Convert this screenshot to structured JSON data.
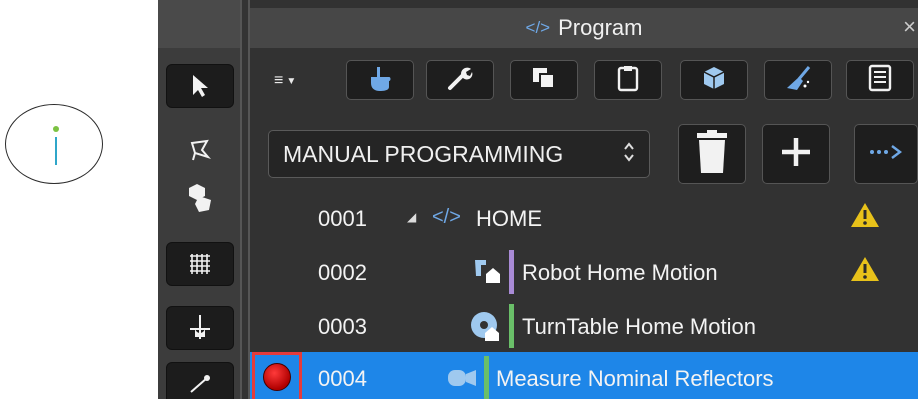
{
  "panel": {
    "title": "Program",
    "close_glyph": "×"
  },
  "left_tools": [
    {
      "name": "select-arrow-icon"
    },
    {
      "name": "lasso-icon"
    },
    {
      "name": "object-select-icon"
    },
    {
      "name": "grid-icon"
    },
    {
      "name": "move-icon"
    },
    {
      "name": "measure-tool-icon"
    }
  ],
  "toolbar": {
    "menu_glyph": "≡",
    "buttons": [
      {
        "name": "hand-icon"
      },
      {
        "name": "wrench-icon"
      },
      {
        "name": "copy-icon"
      },
      {
        "name": "clipboard-icon"
      },
      {
        "name": "cube-icon"
      },
      {
        "name": "broom-icon"
      },
      {
        "name": "list-icon"
      }
    ]
  },
  "program_select": {
    "value": "MANUAL PROGRAMMING",
    "caret": "⌃⌄"
  },
  "tree": {
    "rows": [
      {
        "number": "0001",
        "label": "HOME",
        "bar_color": "",
        "warning": true,
        "selected": false
      },
      {
        "number": "0002",
        "label": "Robot Home Motion",
        "bar_color": "#a98bd6",
        "warning": true,
        "selected": false
      },
      {
        "number": "0003",
        "label": "TurnTable Home Motion",
        "bar_color": "#6abf69",
        "warning": false,
        "selected": false
      },
      {
        "number": "0004",
        "label": "Measure Nominal Reflectors",
        "bar_color": "#6abf69",
        "warning": false,
        "selected": true
      }
    ]
  },
  "colors": {
    "selection": "#1e86e8",
    "accent_blue": "#6fa8e6",
    "warning_yellow": "#e8c21a",
    "breakpoint_red": "#d01010"
  }
}
